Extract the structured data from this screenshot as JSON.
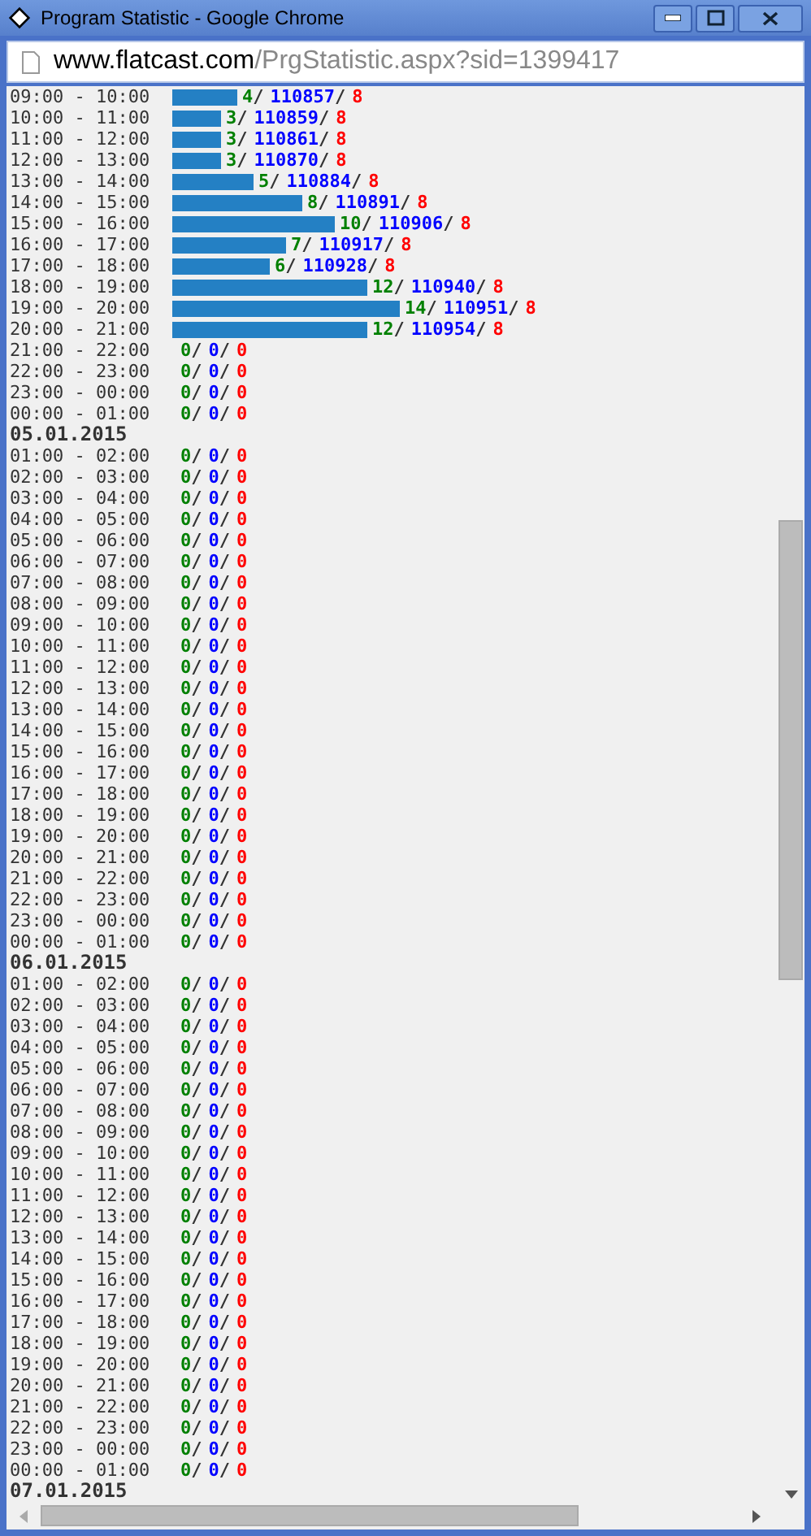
{
  "window": {
    "title": "Program Statistic - Google Chrome"
  },
  "address_bar": {
    "domain": "www.flatcast.com",
    "path": "/PrgStatistic.aspx?sid=1399417"
  },
  "sections": [
    {
      "rows": [
        {
          "time": "09:00 - 10:00",
          "count": "4/",
          "total": "110857/",
          "errors": "8"
        },
        {
          "time": "10:00 - 11:00",
          "count": "3/",
          "total": "110859/",
          "errors": "8"
        },
        {
          "time": "11:00 - 12:00",
          "count": "3/",
          "total": "110861/",
          "errors": "8"
        },
        {
          "time": "12:00 - 13:00",
          "count": "3/",
          "total": "110870/",
          "errors": "8"
        },
        {
          "time": "13:00 - 14:00",
          "count": "5/",
          "total": "110884/",
          "errors": "8"
        },
        {
          "time": "14:00 - 15:00",
          "count": "8/",
          "total": "110891/",
          "errors": "8"
        },
        {
          "time": "15:00 - 16:00",
          "count": "10/",
          "total": "110906/",
          "errors": "8"
        },
        {
          "time": "16:00 - 17:00",
          "count": "7/",
          "total": "110917/",
          "errors": "8"
        },
        {
          "time": "17:00 - 18:00",
          "count": "6/",
          "total": "110928/",
          "errors": "8"
        },
        {
          "time": "18:00 - 19:00",
          "count": "12/",
          "total": "110940/",
          "errors": "8"
        },
        {
          "time": "19:00 - 20:00",
          "count": "14/",
          "total": "110951/",
          "errors": "8"
        },
        {
          "time": "20:00 - 21:00",
          "count": "12/",
          "total": "110954/",
          "errors": "8"
        },
        {
          "time": "21:00 - 22:00",
          "count": "0/",
          "total": "0/",
          "errors": "0"
        },
        {
          "time": "22:00 - 23:00",
          "count": "0/",
          "total": "0/",
          "errors": "0"
        },
        {
          "time": "23:00 - 00:00",
          "count": "0/",
          "total": "0/",
          "errors": "0"
        },
        {
          "time": "00:00 - 01:00",
          "count": "0/",
          "total": "0/",
          "errors": "0"
        }
      ]
    },
    {
      "date": "05.01.2015",
      "rows": [
        {
          "time": "01:00 - 02:00",
          "count": "0/",
          "total": "0/",
          "errors": "0"
        },
        {
          "time": "02:00 - 03:00",
          "count": "0/",
          "total": "0/",
          "errors": "0"
        },
        {
          "time": "03:00 - 04:00",
          "count": "0/",
          "total": "0/",
          "errors": "0"
        },
        {
          "time": "04:00 - 05:00",
          "count": "0/",
          "total": "0/",
          "errors": "0"
        },
        {
          "time": "05:00 - 06:00",
          "count": "0/",
          "total": "0/",
          "errors": "0"
        },
        {
          "time": "06:00 - 07:00",
          "count": "0/",
          "total": "0/",
          "errors": "0"
        },
        {
          "time": "07:00 - 08:00",
          "count": "0/",
          "total": "0/",
          "errors": "0"
        },
        {
          "time": "08:00 - 09:00",
          "count": "0/",
          "total": "0/",
          "errors": "0"
        },
        {
          "time": "09:00 - 10:00",
          "count": "0/",
          "total": "0/",
          "errors": "0"
        },
        {
          "time": "10:00 - 11:00",
          "count": "0/",
          "total": "0/",
          "errors": "0"
        },
        {
          "time": "11:00 - 12:00",
          "count": "0/",
          "total": "0/",
          "errors": "0"
        },
        {
          "time": "12:00 - 13:00",
          "count": "0/",
          "total": "0/",
          "errors": "0"
        },
        {
          "time": "13:00 - 14:00",
          "count": "0/",
          "total": "0/",
          "errors": "0"
        },
        {
          "time": "14:00 - 15:00",
          "count": "0/",
          "total": "0/",
          "errors": "0"
        },
        {
          "time": "15:00 - 16:00",
          "count": "0/",
          "total": "0/",
          "errors": "0"
        },
        {
          "time": "16:00 - 17:00",
          "count": "0/",
          "total": "0/",
          "errors": "0"
        },
        {
          "time": "17:00 - 18:00",
          "count": "0/",
          "total": "0/",
          "errors": "0"
        },
        {
          "time": "18:00 - 19:00",
          "count": "0/",
          "total": "0/",
          "errors": "0"
        },
        {
          "time": "19:00 - 20:00",
          "count": "0/",
          "total": "0/",
          "errors": "0"
        },
        {
          "time": "20:00 - 21:00",
          "count": "0/",
          "total": "0/",
          "errors": "0"
        },
        {
          "time": "21:00 - 22:00",
          "count": "0/",
          "total": "0/",
          "errors": "0"
        },
        {
          "time": "22:00 - 23:00",
          "count": "0/",
          "total": "0/",
          "errors": "0"
        },
        {
          "time": "23:00 - 00:00",
          "count": "0/",
          "total": "0/",
          "errors": "0"
        },
        {
          "time": "00:00 - 01:00",
          "count": "0/",
          "total": "0/",
          "errors": "0"
        }
      ]
    },
    {
      "date": "06.01.2015",
      "rows": [
        {
          "time": "01:00 - 02:00",
          "count": "0/",
          "total": "0/",
          "errors": "0"
        },
        {
          "time": "02:00 - 03:00",
          "count": "0/",
          "total": "0/",
          "errors": "0"
        },
        {
          "time": "03:00 - 04:00",
          "count": "0/",
          "total": "0/",
          "errors": "0"
        },
        {
          "time": "04:00 - 05:00",
          "count": "0/",
          "total": "0/",
          "errors": "0"
        },
        {
          "time": "05:00 - 06:00",
          "count": "0/",
          "total": "0/",
          "errors": "0"
        },
        {
          "time": "06:00 - 07:00",
          "count": "0/",
          "total": "0/",
          "errors": "0"
        },
        {
          "time": "07:00 - 08:00",
          "count": "0/",
          "total": "0/",
          "errors": "0"
        },
        {
          "time": "08:00 - 09:00",
          "count": "0/",
          "total": "0/",
          "errors": "0"
        },
        {
          "time": "09:00 - 10:00",
          "count": "0/",
          "total": "0/",
          "errors": "0"
        },
        {
          "time": "10:00 - 11:00",
          "count": "0/",
          "total": "0/",
          "errors": "0"
        },
        {
          "time": "11:00 - 12:00",
          "count": "0/",
          "total": "0/",
          "errors": "0"
        },
        {
          "time": "12:00 - 13:00",
          "count": "0/",
          "total": "0/",
          "errors": "0"
        },
        {
          "time": "13:00 - 14:00",
          "count": "0/",
          "total": "0/",
          "errors": "0"
        },
        {
          "time": "14:00 - 15:00",
          "count": "0/",
          "total": "0/",
          "errors": "0"
        },
        {
          "time": "15:00 - 16:00",
          "count": "0/",
          "total": "0/",
          "errors": "0"
        },
        {
          "time": "16:00 - 17:00",
          "count": "0/",
          "total": "0/",
          "errors": "0"
        },
        {
          "time": "17:00 - 18:00",
          "count": "0/",
          "total": "0/",
          "errors": "0"
        },
        {
          "time": "18:00 - 19:00",
          "count": "0/",
          "total": "0/",
          "errors": "0"
        },
        {
          "time": "19:00 - 20:00",
          "count": "0/",
          "total": "0/",
          "errors": "0"
        },
        {
          "time": "20:00 - 21:00",
          "count": "0/",
          "total": "0/",
          "errors": "0"
        },
        {
          "time": "21:00 - 22:00",
          "count": "0/",
          "total": "0/",
          "errors": "0"
        },
        {
          "time": "22:00 - 23:00",
          "count": "0/",
          "total": "0/",
          "errors": "0"
        },
        {
          "time": "23:00 - 00:00",
          "count": "0/",
          "total": "0/",
          "errors": "0"
        },
        {
          "time": "00:00 - 01:00",
          "count": "0/",
          "total": "0/",
          "errors": "0"
        }
      ]
    },
    {
      "date": "07.01.2015"
    }
  ]
}
